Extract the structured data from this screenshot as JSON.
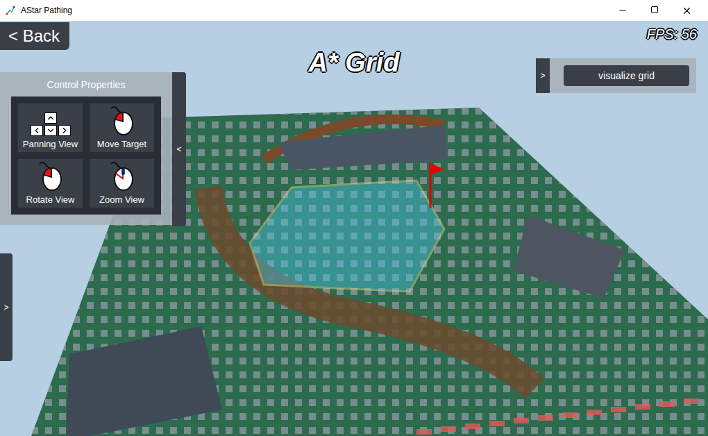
{
  "window": {
    "title": "AStar Pathing"
  },
  "back_button": {
    "label": "< Back"
  },
  "fps": "FPS: 56",
  "heading": "A* Grid",
  "control_panel": {
    "title": "Control Properties",
    "collapse": "<",
    "items": [
      {
        "label": "Panning View",
        "kind": "keys"
      },
      {
        "label": "Move Target",
        "kind": "left-click"
      },
      {
        "label": "Rotate View",
        "kind": "left-click"
      },
      {
        "label": "Zoom View",
        "kind": "wheel"
      }
    ]
  },
  "visualize_panel": {
    "toggle": ">",
    "button": "visualize grid"
  },
  "side_tab": {
    "label": ">"
  }
}
